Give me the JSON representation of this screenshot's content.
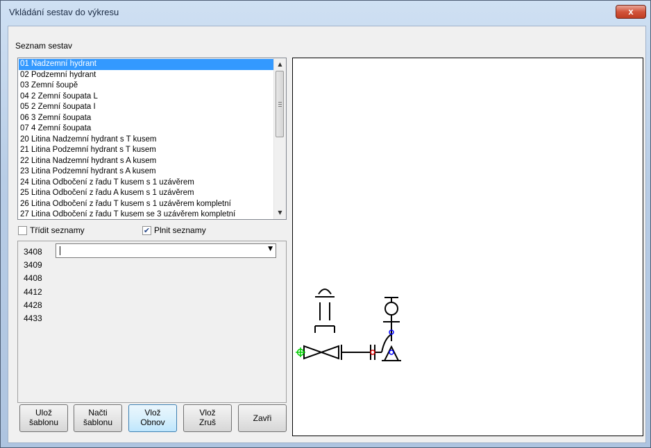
{
  "window": {
    "title": "Vkládání sestav do výkresu",
    "close_label": "x"
  },
  "seznam": {
    "label": "Seznam sestav",
    "items": [
      "01 Nadzemní hydrant",
      "02 Podzemní hydrant",
      "03 Zemní šoupě",
      "04 2 Zemní šoupata L",
      "05 2 Zemní šoupata I",
      "06 3 Zemní šoupata",
      "07 4 Zemní šoupata",
      "20 Litina Nadzemní hydrant s T kusem",
      "21 Litina Podzemní hydrant s T kusem",
      "22 Litina Nadzemní hydrant s A kusem",
      "23 Litina Podzemní hydrant s A kusem",
      "24 Litina Odbočení z řadu T kusem s 1 uzávěrem",
      "25 Litina Odbočení z řadu A kusem s 1 uzávěrem",
      "26 Litina Odbočení z řadu T kusem s 1 uzávěrem kompletní",
      "27 Litina Odbočení z řadu T kusem se 3 uzávěrem kompletní"
    ],
    "selected_index": 0
  },
  "options": {
    "sort_label": "Třídit seznamy",
    "sort_checked": false,
    "fill_label": "Plnit seznamy",
    "fill_checked": true
  },
  "parts": {
    "numbers": [
      "3408",
      "3409",
      "4408",
      "4412",
      "4428",
      "4433"
    ],
    "combo_value": ""
  },
  "buttons": {
    "save_template": [
      "Ulož",
      "šablonu"
    ],
    "load_template": [
      "Načti",
      "šablonu"
    ],
    "insert_refresh": [
      "Vlož",
      "Obnov"
    ],
    "insert_cancel": [
      "Vlož",
      "Zruš"
    ],
    "close": "Zavři"
  }
}
